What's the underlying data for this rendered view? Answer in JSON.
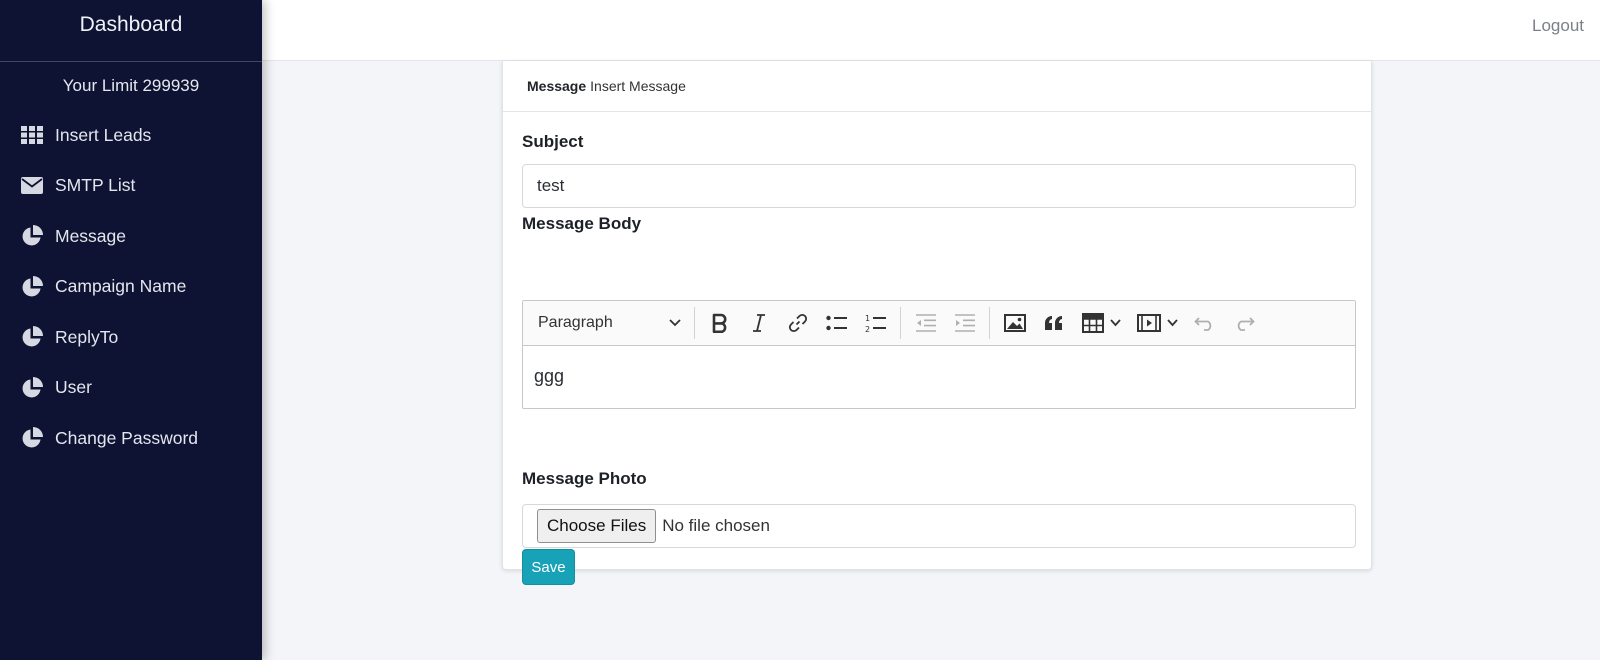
{
  "sidebar": {
    "brand": "Dashboard",
    "limit": "Your Limit 299939",
    "items": [
      {
        "label": "Insert Leads",
        "icon": "grid-icon"
      },
      {
        "label": "SMTP List",
        "icon": "envelope-icon"
      },
      {
        "label": "Message",
        "icon": "pie-chart-icon"
      },
      {
        "label": "Campaign Name",
        "icon": "pie-chart-icon"
      },
      {
        "label": "ReplyTo",
        "icon": "pie-chart-icon"
      },
      {
        "label": "User",
        "icon": "pie-chart-icon"
      },
      {
        "label": "Change Password",
        "icon": "pie-chart-icon"
      }
    ],
    "colors": {
      "background": "#0e1333",
      "text": "#e4e6ed"
    }
  },
  "topbar": {
    "logout": "Logout"
  },
  "card": {
    "header_title": "Message",
    "header_subtitle": "Insert Message",
    "subject": {
      "label": "Subject",
      "value": "test"
    },
    "body": {
      "label": "Message Body",
      "heading_select": "Paragraph",
      "toolbar_icons": [
        "bold-icon",
        "italic-icon",
        "link-icon",
        "bulleted-list-icon",
        "numbered-list-icon",
        "outdent-icon",
        "indent-icon",
        "image-icon",
        "blockquote-icon",
        "table-icon",
        "media-icon",
        "undo-icon",
        "redo-icon"
      ],
      "content": "ggg"
    },
    "photo": {
      "label": "Message Photo",
      "button": "Choose Files",
      "status": "No file chosen"
    },
    "save": "Save"
  },
  "colors": {
    "page_background": "#f4f5f8",
    "save_button": "#17a2b8"
  }
}
